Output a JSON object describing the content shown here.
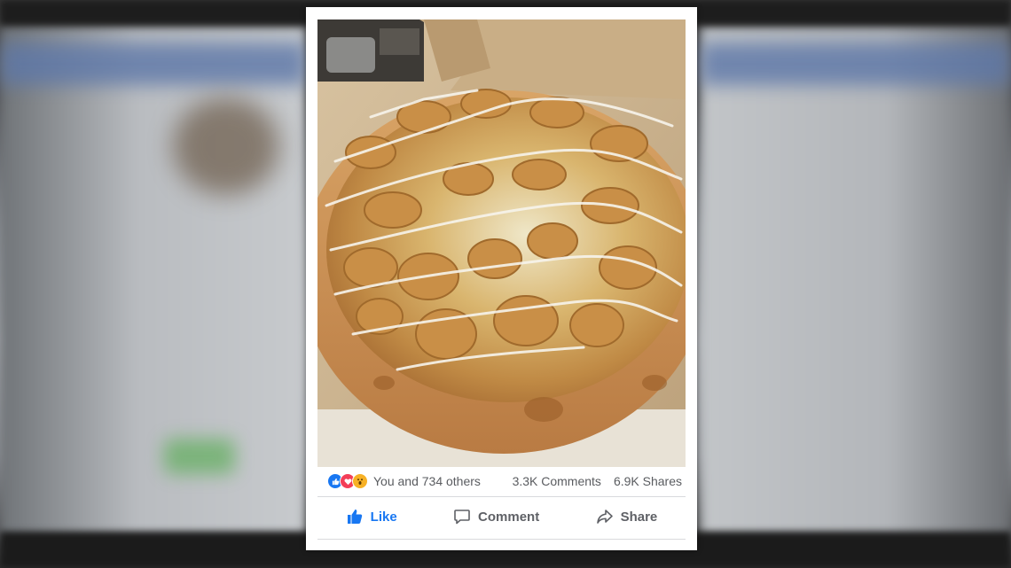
{
  "post": {
    "photo_icon": "pizza-photo",
    "reactions": {
      "icons": [
        "like-icon",
        "love-icon",
        "wow-icon"
      ],
      "colors": {
        "like": "#1877f2",
        "love": "#f33e58",
        "wow": "#f7b125"
      },
      "reactors_text": "You and 734 others",
      "comments_text": "3.3K Comments",
      "shares_text": "6.9K Shares"
    },
    "actions": {
      "like_label": "Like",
      "comment_label": "Comment",
      "share_label": "Share",
      "like_active_color": "#1877f2"
    }
  }
}
